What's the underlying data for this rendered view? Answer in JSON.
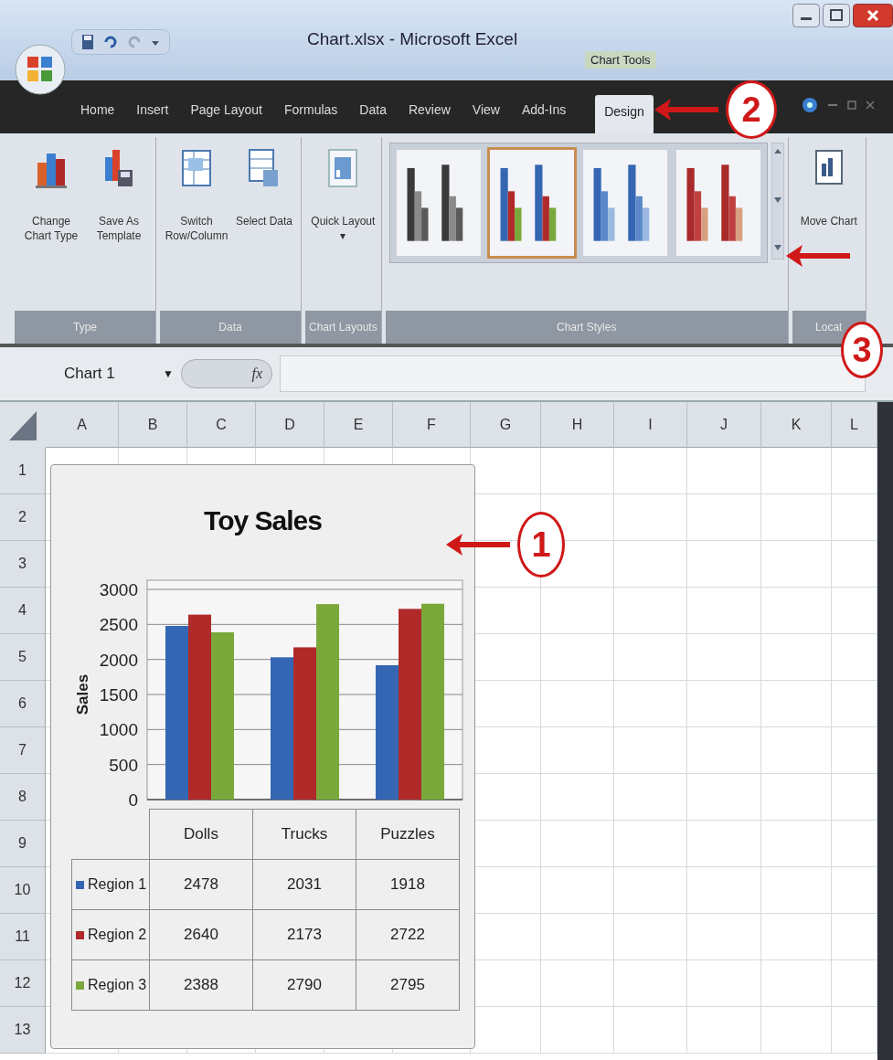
{
  "window": {
    "title": "Chart.xlsx - Microsoft Excel",
    "context_tab_group": "Chart Tools"
  },
  "tabs": [
    {
      "label": "Home",
      "selected": false
    },
    {
      "label": "Insert",
      "selected": false
    },
    {
      "label": "Page Layout",
      "selected": false
    },
    {
      "label": "Formulas",
      "selected": false
    },
    {
      "label": "Data",
      "selected": false
    },
    {
      "label": "Review",
      "selected": false
    },
    {
      "label": "View",
      "selected": false
    },
    {
      "label": "Add-Ins",
      "selected": false
    },
    {
      "label": "Design",
      "selected": true
    }
  ],
  "ribbon": {
    "groups": [
      {
        "label": "Type",
        "buttons": [
          {
            "label": "Change Chart Type",
            "kind": "change"
          },
          {
            "label": "Save As Template",
            "kind": "template"
          }
        ]
      },
      {
        "label": "Data",
        "buttons": [
          {
            "label": "Switch Row/Column",
            "kind": "switch"
          },
          {
            "label": "Select Data",
            "kind": "select"
          }
        ]
      },
      {
        "label": "Chart Layouts",
        "buttons": [
          {
            "label": "Quick Layout ▾",
            "kind": "layout"
          }
        ]
      },
      {
        "label": "Chart Styles",
        "styles": [
          {
            "kind": "gray",
            "selected": false
          },
          {
            "kind": "mixed",
            "selected": true
          },
          {
            "kind": "blue",
            "selected": false
          },
          {
            "kind": "red",
            "selected": false
          }
        ]
      },
      {
        "label": "Locat",
        "buttons": [
          {
            "label": "Move Chart",
            "kind": "move"
          }
        ]
      }
    ]
  },
  "formula_bar": {
    "name_box": "Chart 1",
    "dropdown": "▼",
    "function_label": "fx"
  },
  "sheet": {
    "columns": [
      "A",
      "B",
      "C",
      "D",
      "E",
      "F",
      "G",
      "H",
      "I",
      "J",
      "K",
      "L"
    ],
    "rows": [
      "1",
      "2",
      "3",
      "4",
      "5",
      "6",
      "7",
      "8",
      "9",
      "10",
      "11",
      "12",
      "13"
    ]
  },
  "chart": {
    "chart_data": {
      "type": "bar",
      "title": "Toy Sales",
      "ylabel": "Sales",
      "categories": [
        "Dolls",
        "Trucks",
        "Puzzles"
      ],
      "ylim": [
        0,
        3000
      ],
      "yticks": [
        0,
        500,
        1000,
        1500,
        2000,
        2500,
        3000
      ],
      "grid": true,
      "legend": true,
      "series": [
        {
          "name": "Region 1",
          "color": "#3566b4",
          "values": [
            2478,
            2031,
            1918
          ]
        },
        {
          "name": "Region 2",
          "color": "#b02a2a",
          "values": [
            2640,
            2173,
            2722
          ]
        },
        {
          "name": "Region 3",
          "color": "#7aa83a",
          "values": [
            2388,
            2790,
            2795
          ]
        }
      ]
    },
    "data_table": {
      "rows": [
        [
          "2478",
          "2031",
          "1918"
        ],
        [
          "2640",
          "2173",
          "2722"
        ],
        [
          "2388",
          "2790",
          "2795"
        ]
      ]
    }
  },
  "callouts": [
    {
      "number": "1"
    },
    {
      "number": "2"
    },
    {
      "number": "3"
    }
  ]
}
